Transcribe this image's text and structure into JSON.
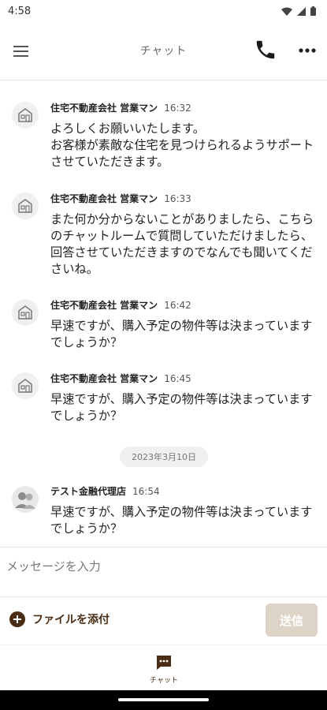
{
  "status_bar": {
    "time": "4:58"
  },
  "header": {
    "title": "チャット"
  },
  "messages": [
    {
      "sender": "住宅不動産会社 営業マン",
      "time": "16:32",
      "text": "よろしくお願いいたします。\nお客様が素敵な住宅を見つけられるようサポートさせていただきます。",
      "avatar": "building-icon"
    },
    {
      "sender": "住宅不動産会社 営業マン",
      "time": "16:33",
      "text": "また何か分からないことがありましたら、こちらのチャットルームで質問していただけましたら、回答させていただきますのでなんでも聞いてくださいね。",
      "avatar": "building-icon"
    },
    {
      "sender": "住宅不動産会社 営業マン",
      "time": "16:42",
      "text": "早速ですが、購入予定の物件等は決まっていますでしょうか？",
      "avatar": "building-icon"
    },
    {
      "sender": "住宅不動産会社 営業マン",
      "time": "16:45",
      "text": "早速ですが、購入予定の物件等は決まっていますでしょうか？",
      "avatar": "building-icon"
    },
    {
      "sender": "テスト金融代理店",
      "time": "16:54",
      "text": "早速ですが、購入予定の物件等は決まっていますでしょうか？",
      "avatar": "people-icon"
    }
  ],
  "date_separator": "2023年3月10日",
  "composer": {
    "placeholder": "メッセージを入力",
    "attach_label": "ファイルを添付",
    "send_label": "送信"
  },
  "bottom_nav": {
    "chat_label": "チャット"
  },
  "colors": {
    "accent": "#4a2d14",
    "send_disabled": "#ddd3c6"
  }
}
